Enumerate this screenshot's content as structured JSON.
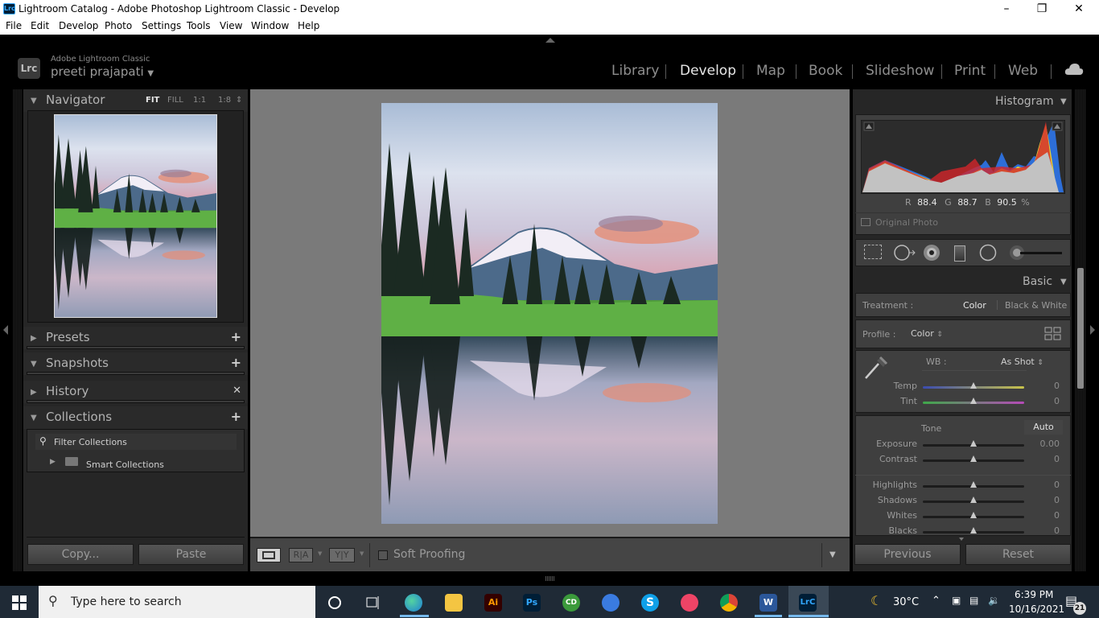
{
  "window": {
    "app_icon": "Lrc",
    "title": "Lightroom Catalog - Adobe Photoshop Lightroom Classic - Develop",
    "controls": [
      "minimize",
      "restore",
      "close"
    ]
  },
  "menu": [
    "File",
    "Edit",
    "Develop",
    "Photo",
    "Settings",
    "Tools",
    "View",
    "Window",
    "Help"
  ],
  "identity": {
    "badge": "Lrc",
    "product": "Adobe Lightroom Classic",
    "user": "preeti prajapati"
  },
  "modules": [
    {
      "label": "Library",
      "active": false
    },
    {
      "label": "Develop",
      "active": true
    },
    {
      "label": "Map",
      "active": false
    },
    {
      "label": "Book",
      "active": false
    },
    {
      "label": "Slideshow",
      "active": false
    },
    {
      "label": "Print",
      "active": false
    },
    {
      "label": "Web",
      "active": false
    }
  ],
  "left_panel": {
    "navigator": {
      "label": "Navigator",
      "zoom_options": [
        "FIT",
        "FILL",
        "1:1",
        "1:8"
      ],
      "selected_zoom": "FIT"
    },
    "presets": {
      "label": "Presets"
    },
    "snapshots": {
      "label": "Snapshots"
    },
    "history": {
      "label": "History"
    },
    "collections": {
      "label": "Collections",
      "filter_placeholder": "Filter Collections",
      "items": [
        "Smart Collections"
      ]
    },
    "copy_label": "Copy...",
    "paste_label": "Paste"
  },
  "toolbar": {
    "soft_proofing_label": "Soft Proofing",
    "soft_proofing_checked": false,
    "before_after_1": "R|A",
    "before_after_2": "Y|Y"
  },
  "right_panel": {
    "histogram": {
      "label": "Histogram",
      "r_label": "R",
      "r_value": "88.4",
      "g_label": "G",
      "g_value": "88.7",
      "b_label": "B",
      "b_value": "90.5",
      "unit": "%",
      "original_photo_label": "Original Photo"
    },
    "basic": {
      "label": "Basic",
      "treatment_label": "Treatment :",
      "treatment_color": "Color",
      "treatment_bw": "Black & White",
      "profile_label": "Profile :",
      "profile_value": "Color",
      "wb_label": "WB :",
      "wb_value": "As Shot",
      "tone_label": "Tone",
      "auto_label": "Auto",
      "sliders": [
        {
          "label": "Temp",
          "value": "0",
          "position": 0.5
        },
        {
          "label": "Tint",
          "value": "0",
          "position": 0.5
        },
        {
          "label": "Exposure",
          "value": "0.00",
          "position": 0.5
        },
        {
          "label": "Contrast",
          "value": "0",
          "position": 0.5
        },
        {
          "label": "Highlights",
          "value": "0",
          "position": 0.5
        },
        {
          "label": "Shadows",
          "value": "0",
          "position": 0.5
        },
        {
          "label": "Whites",
          "value": "0",
          "position": 0.5
        },
        {
          "label": "Blacks",
          "value": "0",
          "position": 0.5
        }
      ]
    },
    "previous_label": "Previous",
    "reset_label": "Reset"
  },
  "taskbar": {
    "search_placeholder": "Type here to search",
    "apps": [
      "Cortana",
      "Task View",
      "Edge",
      "File Explorer",
      "Illustrator",
      "Photoshop",
      "CD",
      "App",
      "Skype",
      "Snip",
      "Chrome",
      "Word",
      "Lightroom Classic"
    ],
    "weather": "30°C",
    "time": "6:39 PM",
    "date": "10/16/2021",
    "notifications": "21"
  },
  "colors": {
    "accent_taskbar": "#76b9ed",
    "panel_bg": "#262626",
    "canvas_bg": "#7a7a7a"
  }
}
